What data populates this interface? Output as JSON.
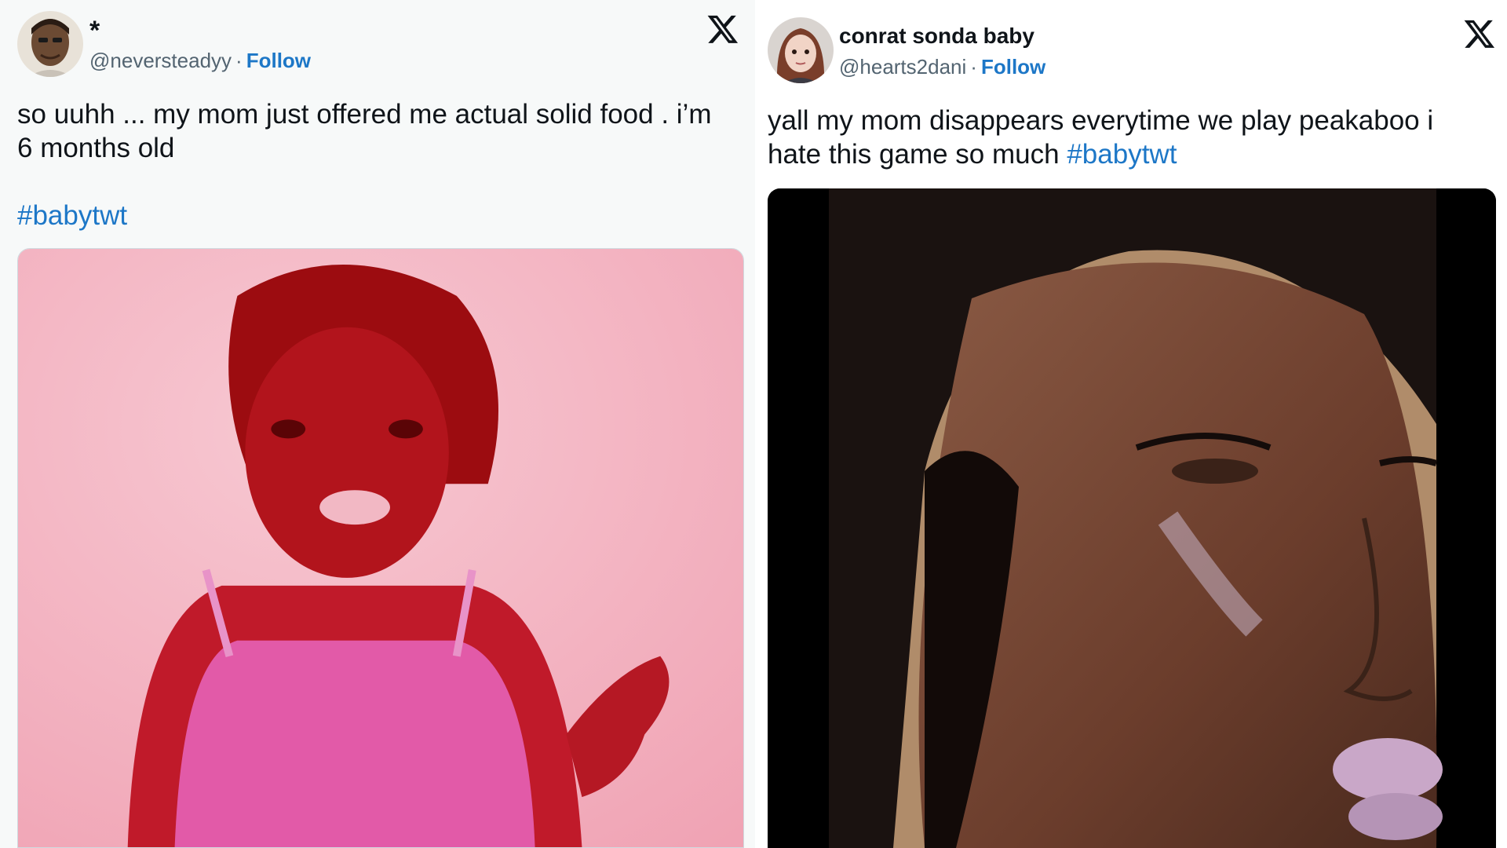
{
  "tweets": [
    {
      "display_name": "*",
      "handle": "@neversteadyy",
      "separator": "·",
      "follow_label": "Follow",
      "text_line1": "so uuhh ... my mom just offered me actual solid food . i’m",
      "text_line2": "6 months old",
      "hashtag": "#babytwt",
      "media": "pink-tinted dancing woman gif"
    },
    {
      "display_name": "conrat sonda baby",
      "handle": "@hearts2dani",
      "separator": "·",
      "follow_label": "Follow",
      "text_line1": "yall my mom disappears everytime we play peakaboo i",
      "text_line2": "hate this game so much",
      "hashtag": "#babytwt",
      "media": "close-up face of crying woman"
    }
  ],
  "icons": {
    "x_logo": "x-logo-icon"
  },
  "colors": {
    "link": "#1d77c7",
    "handle": "#536471",
    "text": "#0f1419"
  }
}
